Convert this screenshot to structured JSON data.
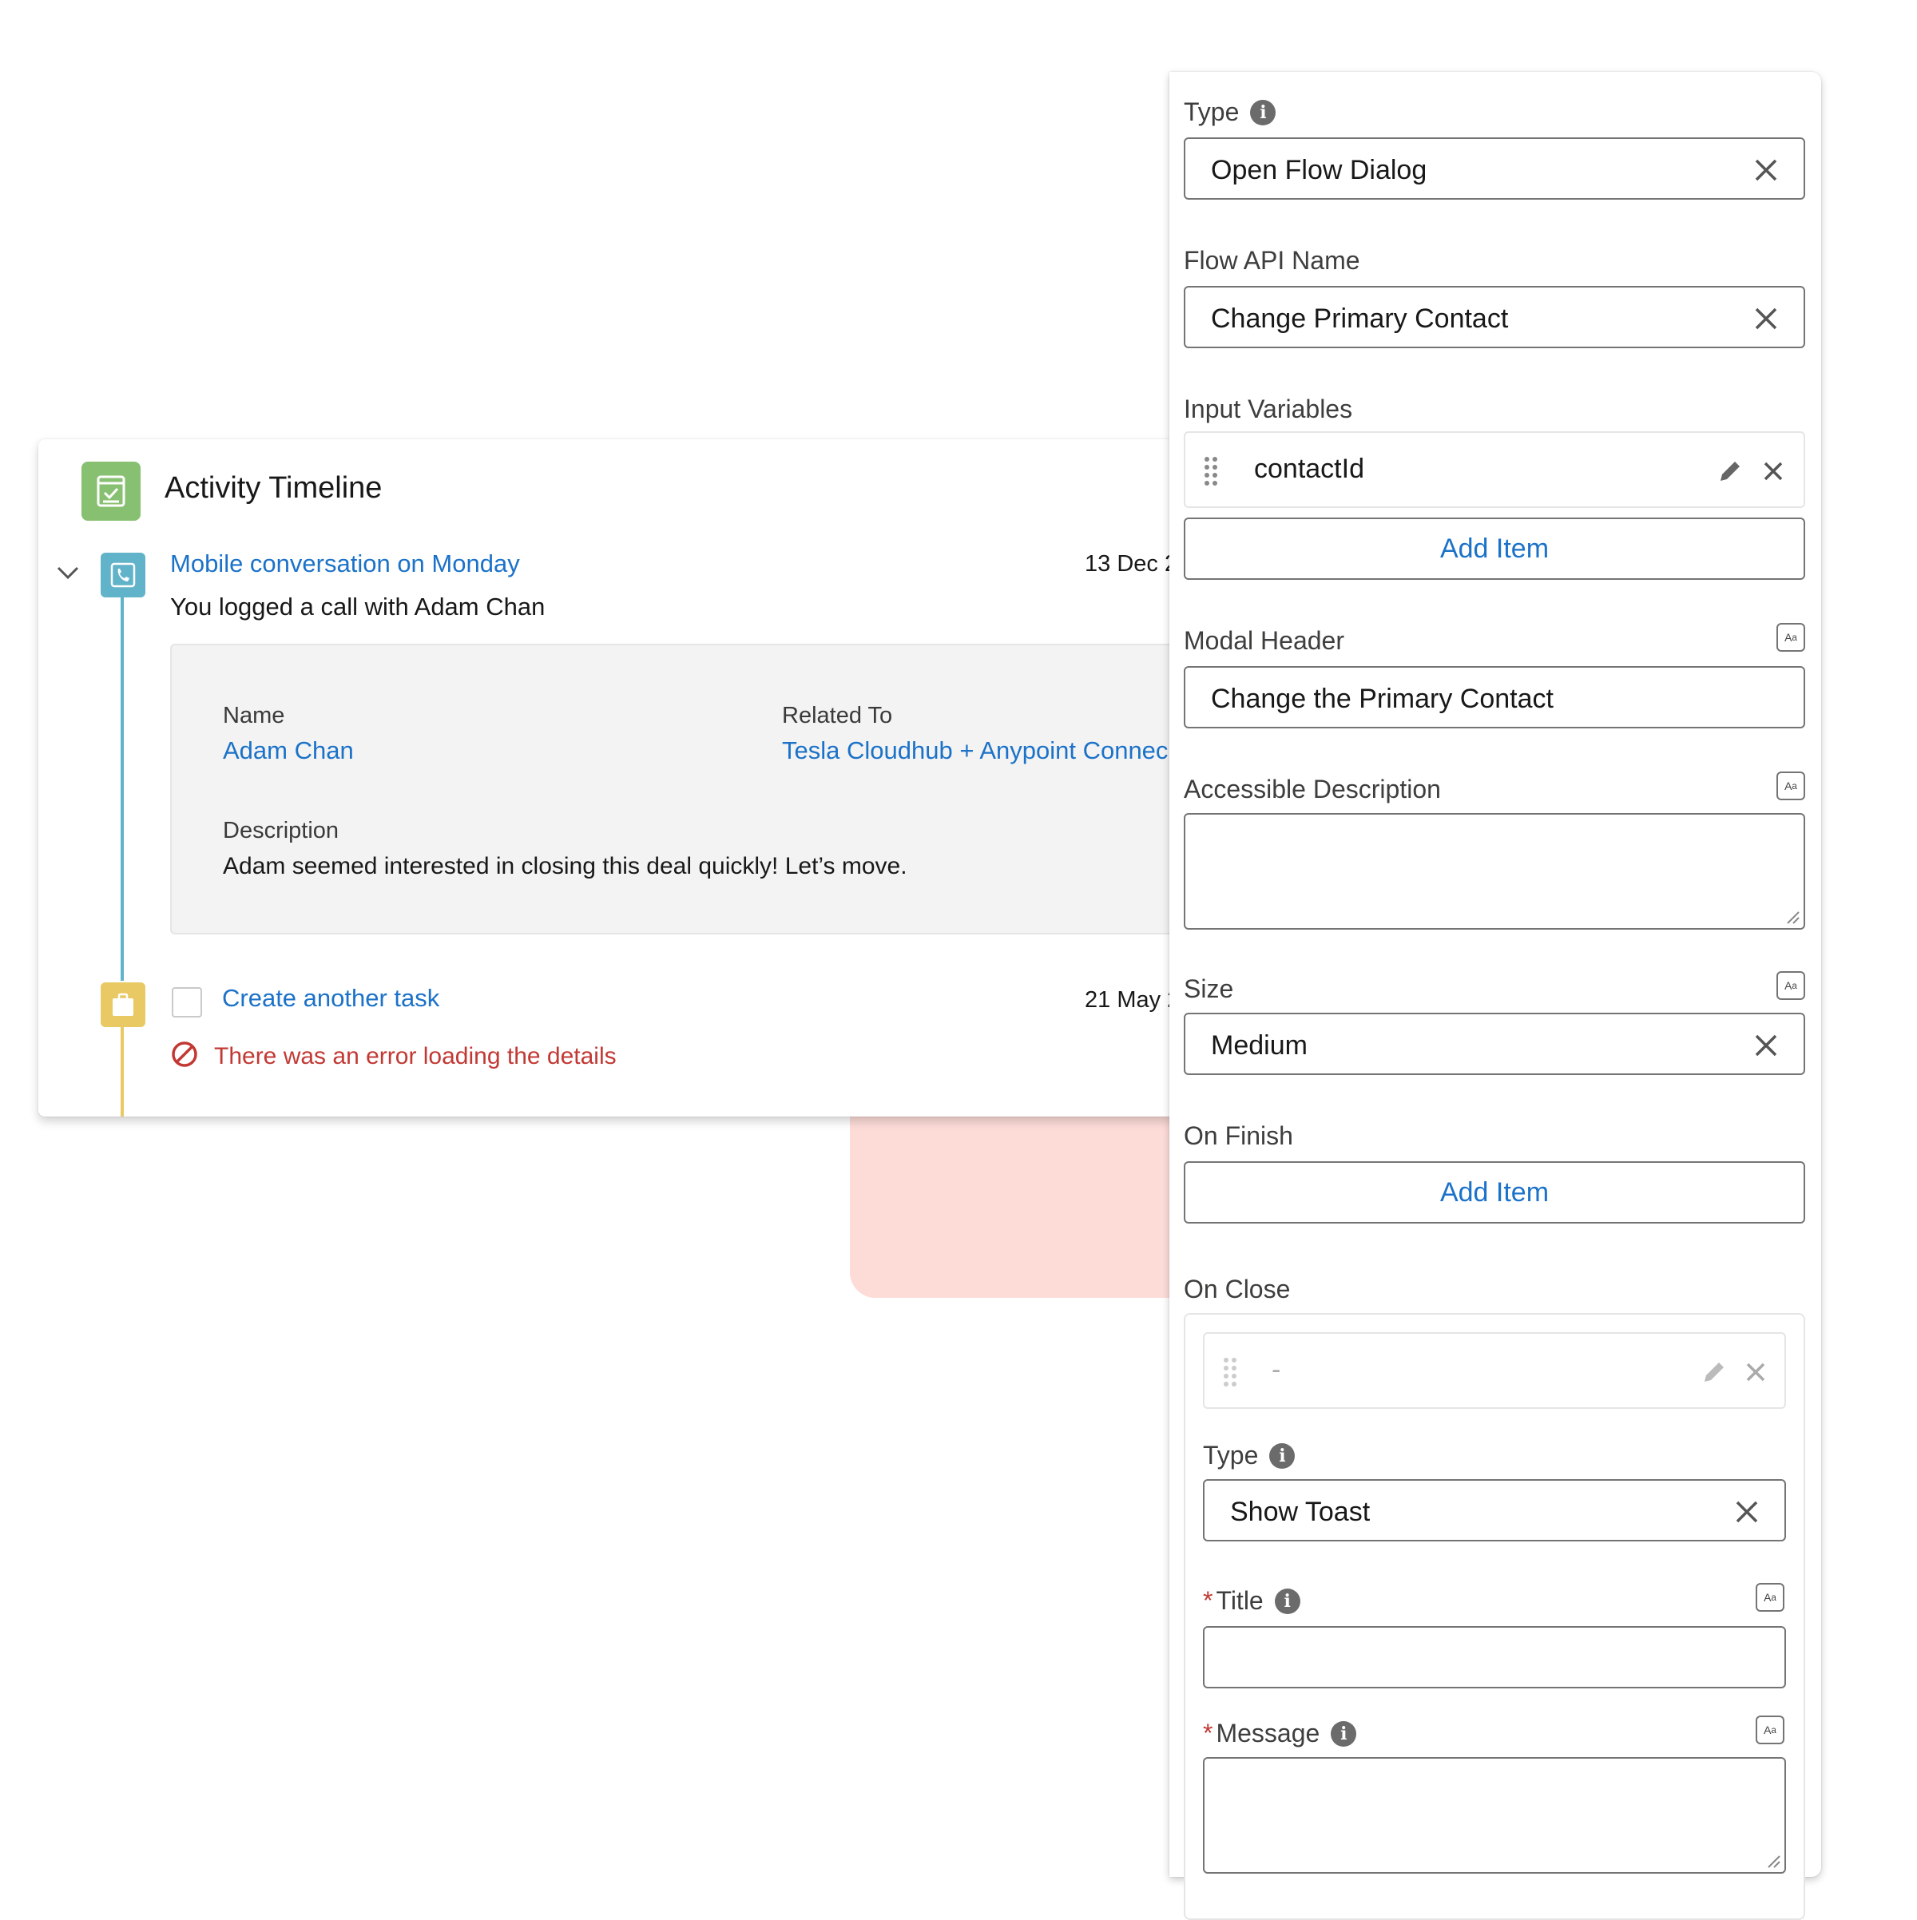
{
  "timeline": {
    "title": "Activity Timeline",
    "items": [
      {
        "title": "Mobile conversation on Monday",
        "date": "13 Dec 2",
        "subtitle": "You logged a call with Adam Chan",
        "details": {
          "name_label": "Name",
          "name_value": "Adam Chan",
          "related_label": "Related To",
          "related_value": "Tesla Cloudhub + Anypoint Connec",
          "description_label": "Description",
          "description_value": "Adam seemed interested in closing this deal quickly! Let’s move."
        }
      },
      {
        "title": "Create another task",
        "date": "21 May 2",
        "error": "There was an error loading the details"
      }
    ]
  },
  "panel": {
    "type_label": "Type",
    "type_value": "Open Flow Dialog",
    "flow_api_label": "Flow API Name",
    "flow_api_value": "Change Primary Contact",
    "input_vars_label": "Input Variables",
    "input_vars": [
      {
        "name": "contactId"
      }
    ],
    "add_item_label": "Add Item",
    "modal_header_label": "Modal Header",
    "modal_header_value": "Change the Primary Contact",
    "accessible_desc_label": "Accessible Description",
    "accessible_desc_value": "",
    "size_label": "Size",
    "size_value": "Medium",
    "on_finish_label": "On Finish",
    "on_finish_add_label": "Add Item",
    "on_close_label": "On Close",
    "on_close": {
      "item_placeholder": "-",
      "type_label": "Type",
      "type_value": "Show Toast",
      "title_label": "Title",
      "title_value": "",
      "message_label": "Message",
      "message_value": "",
      "required_mark": "*"
    }
  },
  "colors": {
    "link": "#1b72c8",
    "error": "#c23934",
    "timeline_icon": "#88c071",
    "call_icon": "#60b3c9",
    "task_icon": "#e8c964",
    "backdrop": "#fddcd8"
  }
}
